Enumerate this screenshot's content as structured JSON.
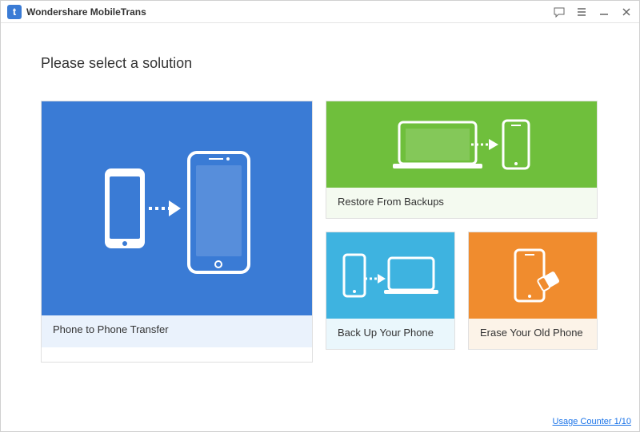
{
  "titlebar": {
    "app_name": "Wondershare MobileTrans"
  },
  "heading": "Please select a solution",
  "cards": {
    "phone_to_phone": "Phone to Phone Transfer",
    "restore": "Restore From Backups",
    "backup": "Back Up Your Phone",
    "erase": "Erase Your Old Phone"
  },
  "footer": {
    "usage_counter": "Usage Counter 1/10"
  },
  "colors": {
    "blue": "#3a7bd5",
    "green": "#6fbf3c",
    "cyan": "#3eb3e0",
    "orange": "#f08c2e"
  }
}
